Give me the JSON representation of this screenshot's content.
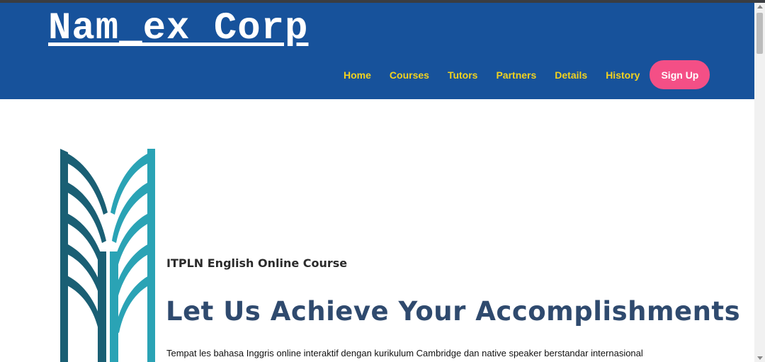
{
  "header": {
    "brand": "Nam_ex Corp",
    "nav": [
      {
        "label": "Home"
      },
      {
        "label": "Courses"
      },
      {
        "label": "Tutors"
      },
      {
        "label": "Partners"
      },
      {
        "label": "Details"
      },
      {
        "label": "History"
      }
    ],
    "signup_label": "Sign Up",
    "colors": {
      "header_bg": "#17529b",
      "nav_text": "#f2d21f",
      "signup_bg": "#f44f86"
    }
  },
  "hero": {
    "logo_icon": "itpln-logo-icon",
    "subtitle": "ITPLN English Online Course",
    "headline": "Let Us Achieve Your Accomplishments",
    "description": "Tempat les bahasa Inggris online interaktif dengan kurikulum Cambridge dan native speaker berstandar internasional"
  }
}
